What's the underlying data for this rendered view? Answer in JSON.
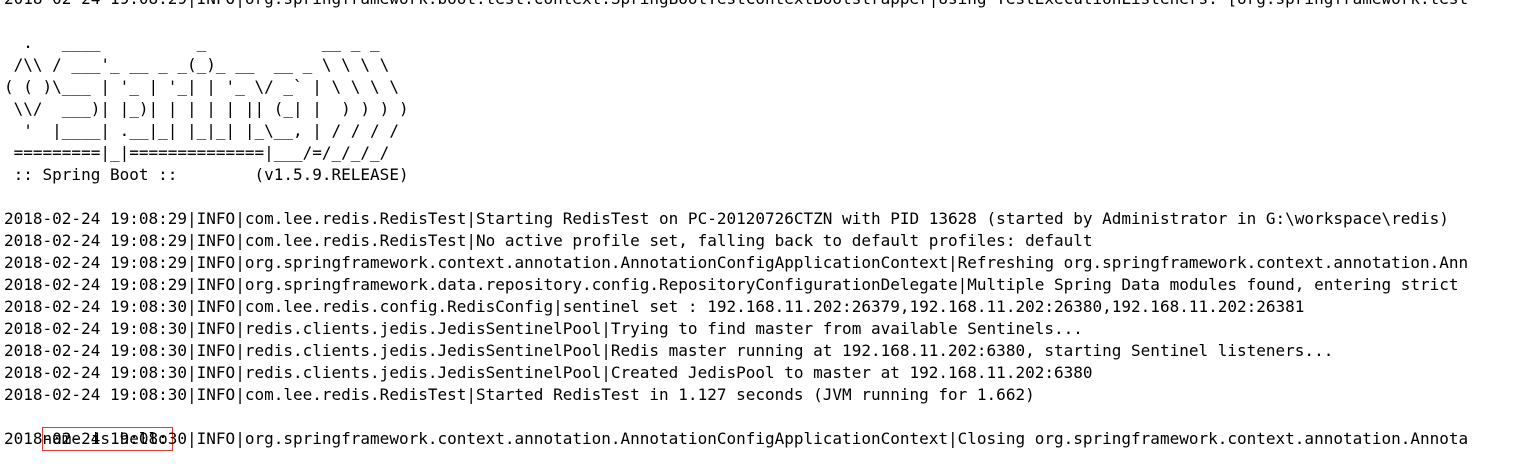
{
  "console": {
    "first_line": "2018-02-24 19:08:29|INFO|org.springframework.boot.test.context.SpringBootTestContextBootstrapper|Using TestExecutionListeners: [org.springframework.test",
    "banner": "  .   ____          _            __ _ _\n /\\\\ / ___'_ __ _ _(_)_ __  __ _ \\ \\ \\ \\\n( ( )\\___ | '_ | '_| | '_ \\/ _` | \\ \\ \\ \\\n \\\\/  ___)| |_)| | | | | || (_| |  ) ) ) )\n  '  |____| .__|_| |_|_| |_\\__, | / / / /\n =========|_|==============|___/=/_/_/_/\n :: Spring Boot ::        (v1.5.9.RELEASE)",
    "log_lines": [
      "2018-02-24 19:08:29|INFO|com.lee.redis.RedisTest|Starting RedisTest on PC-20120726CTZN with PID 13628 (started by Administrator in G:\\workspace\\redis)",
      "2018-02-24 19:08:29|INFO|com.lee.redis.RedisTest|No active profile set, falling back to default profiles: default",
      "2018-02-24 19:08:29|INFO|org.springframework.context.annotation.AnnotationConfigApplicationContext|Refreshing org.springframework.context.annotation.Ann",
      "2018-02-24 19:08:29|INFO|org.springframework.data.repository.config.RepositoryConfigurationDelegate|Multiple Spring Data modules found, entering strict",
      "2018-02-24 19:08:30|INFO|com.lee.redis.config.RedisConfig|sentinel set : 192.168.11.202:26379,192.168.11.202:26380,192.168.11.202:26381",
      "2018-02-24 19:08:30|INFO|redis.clients.jedis.JedisSentinelPool|Trying to find master from available Sentinels...",
      "2018-02-24 19:08:30|INFO|redis.clients.jedis.JedisSentinelPool|Redis master running at 192.168.11.202:6380, starting Sentinel listeners...",
      "2018-02-24 19:08:30|INFO|redis.clients.jedis.JedisSentinelPool|Created JedisPool to master at 192.168.11.202:6380",
      "2018-02-24 19:08:30|INFO|com.lee.redis.RedisTest|Started RedisTest in 1.127 seconds (JVM running for 1.662)"
    ],
    "highlighted_output": "name is hello",
    "last_line": "2018-02-24 19:08:30|INFO|org.springframework.context.annotation.AnnotationConfigApplicationContext|Closing org.springframework.context.annotation.Annota",
    "highlight_color": "#e03c31"
  }
}
